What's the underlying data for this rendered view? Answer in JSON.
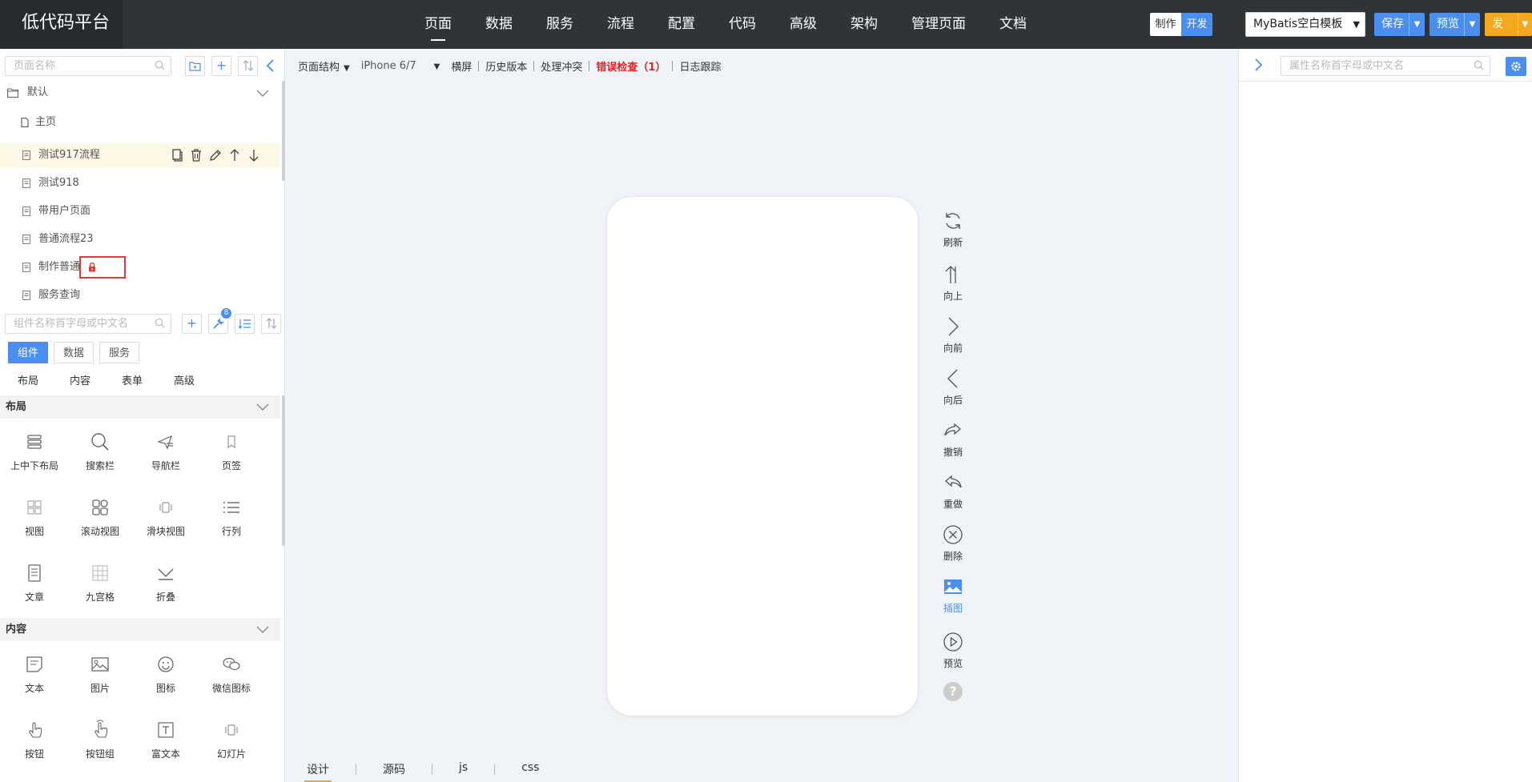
{
  "app": {
    "title": "低代码平台"
  },
  "nav": {
    "items": [
      "页面",
      "数据",
      "服务",
      "流程",
      "配置",
      "代码",
      "高级",
      "架构",
      "管理页面",
      "文档"
    ],
    "active_index": 0
  },
  "mode": {
    "make": "制作",
    "dev": "开发"
  },
  "template": {
    "selected": "MyBatis空白模板"
  },
  "actions": {
    "save": "保存",
    "preview": "预览",
    "publish": "发布"
  },
  "colors": {
    "accent": "#4a8ff0",
    "publish": "#f5a81d",
    "error": "#e52222",
    "topbar": "#2f3439"
  },
  "left_panel": {
    "page_search": {
      "placeholder": "页面名称"
    },
    "toolbar_icons": [
      "folder-add-icon",
      "plus-icon",
      "sort-icon",
      "collapse-left-icon"
    ],
    "folder": {
      "name": "默认"
    },
    "pages": [
      {
        "name": "主页",
        "selected": false
      },
      {
        "name": "测试917流程",
        "selected": true
      },
      {
        "name": "测试918",
        "selected": false
      },
      {
        "name": "带用户页面",
        "selected": false
      },
      {
        "name": "普通流程23",
        "selected": false
      },
      {
        "name": "制作普通",
        "selected": false,
        "locked": true
      },
      {
        "name": "服务查询",
        "selected": false
      }
    ],
    "row_actions": [
      "copy-icon",
      "delete-icon",
      "edit-icon",
      "move-up-icon",
      "move-down-icon"
    ],
    "component_search": {
      "placeholder": "组件名称首字母或中文名"
    },
    "wrench_badge": "8",
    "tabs": [
      "组件",
      "数据",
      "服务"
    ],
    "active_tab": 0,
    "subtabs": [
      "布局",
      "内容",
      "表单",
      "高级"
    ],
    "sections": [
      {
        "title": "布局",
        "items": [
          {
            "label": "上中下布局",
            "icon": "stack-layout-icon"
          },
          {
            "label": "搜索栏",
            "icon": "search-icon"
          },
          {
            "label": "导航栏",
            "icon": "navbar-icon"
          },
          {
            "label": "页签",
            "icon": "bookmark-icon"
          },
          {
            "label": "视图",
            "icon": "grid-view-icon"
          },
          {
            "label": "滚动视图",
            "icon": "scroll-view-icon"
          },
          {
            "label": "滑块视图",
            "icon": "slider-view-icon"
          },
          {
            "label": "行列",
            "icon": "rows-icon"
          },
          {
            "label": "文章",
            "icon": "article-icon"
          },
          {
            "label": "九宫格",
            "icon": "nine-grid-icon"
          },
          {
            "label": "折叠",
            "icon": "fold-icon"
          }
        ]
      },
      {
        "title": "内容",
        "items": [
          {
            "label": "文本",
            "icon": "text-icon"
          },
          {
            "label": "图片",
            "icon": "image-icon"
          },
          {
            "label": "图标",
            "icon": "smiley-icon"
          },
          {
            "label": "微信图标",
            "icon": "wechat-icon"
          },
          {
            "label": "按钮",
            "icon": "tap-icon"
          },
          {
            "label": "按钮组",
            "icon": "tap-group-icon"
          },
          {
            "label": "富文本",
            "icon": "rich-text-icon"
          },
          {
            "label": "幻灯片",
            "icon": "slideshow-icon"
          }
        ]
      }
    ]
  },
  "canvas": {
    "toolbar": {
      "structure": "页面结构",
      "device": "iPhone 6/7",
      "landscape": "横屏",
      "history": "历史版本",
      "conflict": "处理冲突",
      "error_check": "错误检查（1）",
      "log": "日志跟踪"
    },
    "side_tools": [
      {
        "label": "刷新",
        "icon": "refresh-icon"
      },
      {
        "label": "向上",
        "icon": "arrow-up-icon"
      },
      {
        "label": "向前",
        "icon": "chevron-right-icon"
      },
      {
        "label": "向后",
        "icon": "chevron-left-icon"
      },
      {
        "label": "撤销",
        "icon": "undo-icon"
      },
      {
        "label": "重做",
        "icon": "redo-icon"
      },
      {
        "label": "删除",
        "icon": "delete-circle-icon"
      },
      {
        "label": "插图",
        "icon": "insert-image-icon",
        "active": true
      },
      {
        "label": "预览",
        "icon": "play-circle-icon"
      }
    ],
    "help": "?",
    "bottom_tabs": [
      "设计",
      "源码",
      "js",
      "css"
    ],
    "bottom_active": 0
  },
  "right_panel": {
    "search": {
      "placeholder": "属性名称首字母或中文名"
    }
  }
}
